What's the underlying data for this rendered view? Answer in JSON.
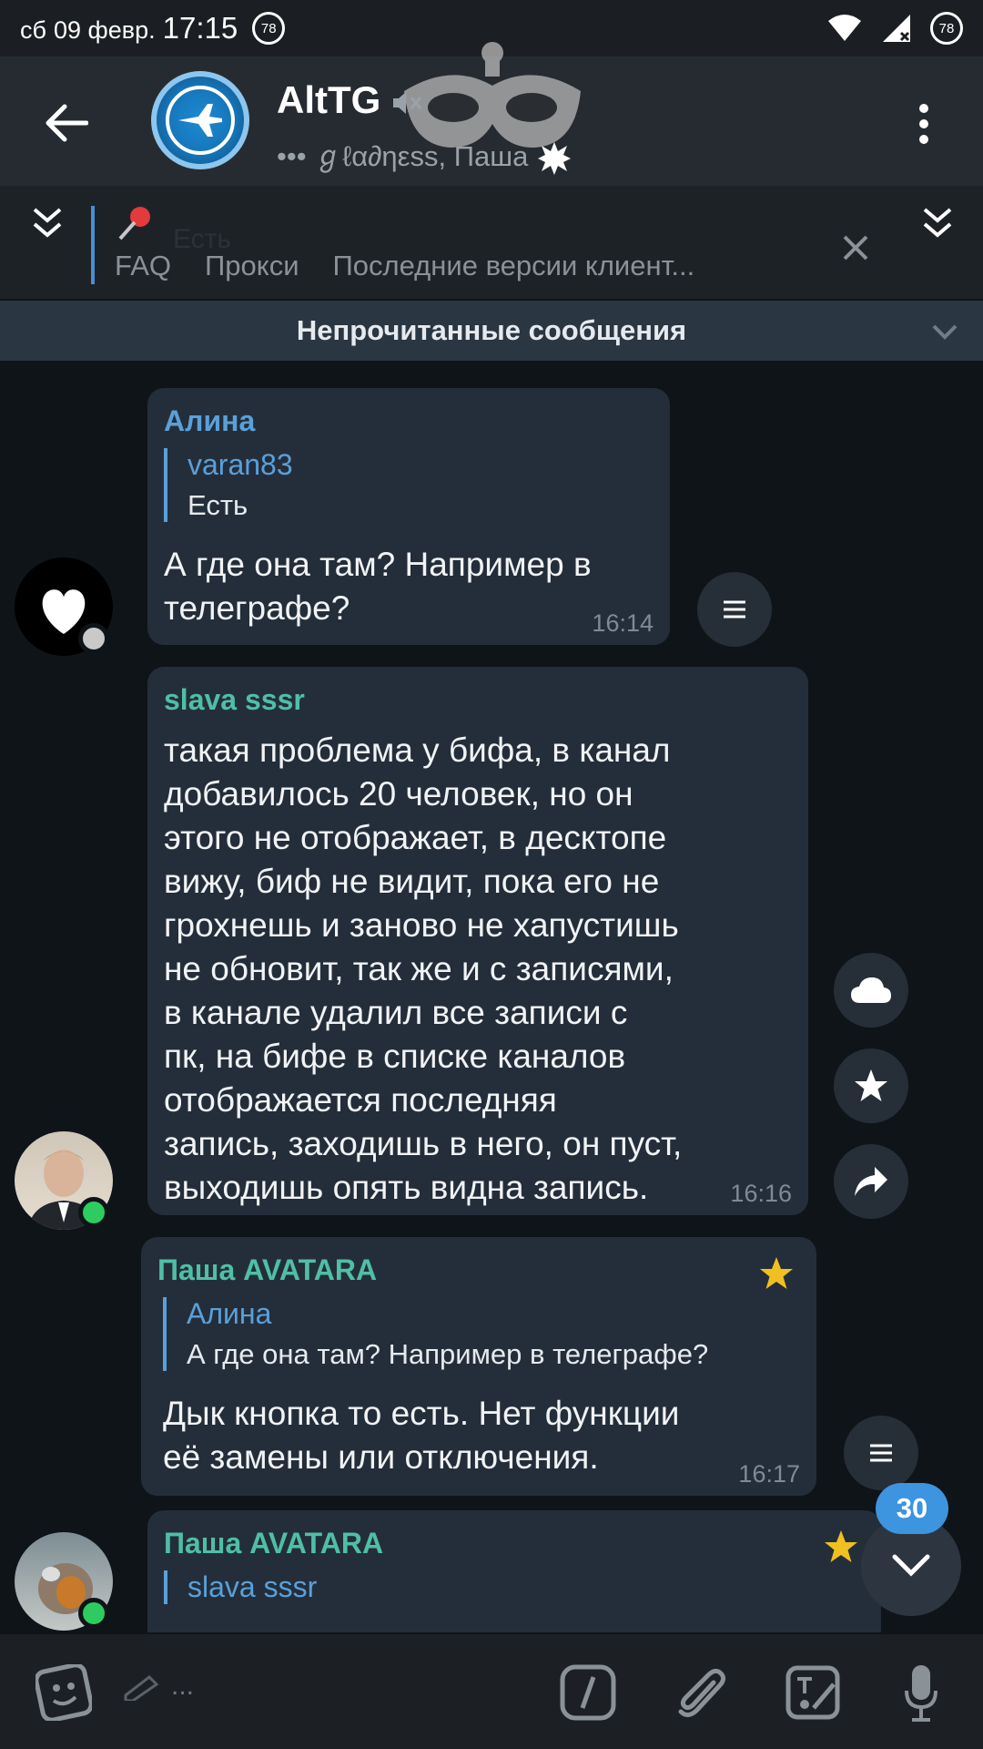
{
  "status_bar": {
    "day": "сб",
    "date": "09 февр.",
    "time": "17:15",
    "notif_badge": "78",
    "battery": "78"
  },
  "header": {
    "title": "AltTG",
    "subtitle": "••• ℊℓα∂ηεss, Паша",
    "avatar_bg": "#1675b8"
  },
  "pinned": {
    "ghost_text": "Есть",
    "links": [
      "FAQ",
      "Прокси",
      "Последние версии клиент..."
    ]
  },
  "unread_banner": "Непрочитанные сообщения",
  "messages": [
    {
      "sender": "Алина",
      "reply_name": "varan83",
      "reply_text": "Есть",
      "lines": [
        "А где она там? Например в",
        "телеграфе?"
      ],
      "time": "16:14"
    },
    {
      "sender": "slava sssr",
      "lines": [
        "такая проблема у бифа, в канал",
        "добавилось 20 человек, но он",
        "этого не отображает, в десктопе",
        "вижу, биф не видит, пока его не",
        "грохнешь и заново не хапустишь",
        "не обновит, так же и с записями,",
        "в канале удалил все записи с",
        "пк, на бифе в списке каналов",
        "отображается последняя",
        "запись, заходишь в него, он пуст,",
        "выходишь опять видна запись."
      ],
      "time": "16:16"
    },
    {
      "sender": "Паша AVATARA",
      "reply_name": "Алина",
      "reply_text": "А где она там? Например в телеграфе?",
      "lines": [
        "Дык кнопка то есть. Нет функции",
        "её замены или отключения."
      ],
      "time": "16:17"
    },
    {
      "sender": "Паша AVATARA",
      "reply_name": "slava sssr",
      "reply_text": "",
      "lines": [],
      "time": ""
    }
  ],
  "scroll_unread_count": "30",
  "input": {
    "placeholder": "..."
  },
  "colors": {
    "accent": "#3d94df",
    "bubble": "#242e3a",
    "sender_blue": "#5aa0da",
    "sender_teal": "#4fbfa6",
    "star": "#f0c020"
  }
}
